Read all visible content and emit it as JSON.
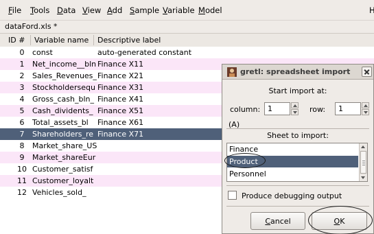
{
  "menubar": {
    "items": [
      {
        "accel": "F",
        "rest": "ile"
      },
      {
        "accel": "T",
        "rest": "ools"
      },
      {
        "accel": "D",
        "rest": "ata"
      },
      {
        "accel": "V",
        "rest": "iew"
      },
      {
        "accel": "A",
        "rest": "dd"
      },
      {
        "accel": "S",
        "rest": "ample"
      },
      {
        "accel": "V",
        "rest": "ariable"
      },
      {
        "accel": "M",
        "rest": "odel"
      }
    ],
    "partial_item": "H"
  },
  "window": {
    "filename": "dataFord.xls *"
  },
  "table": {
    "headers": {
      "id": "ID #",
      "name": "Variable name",
      "desc": "Descriptive label"
    },
    "rows": [
      {
        "id": "0",
        "name": "const",
        "desc": "auto-generated constant"
      },
      {
        "id": "1",
        "name": "Net_income__bln",
        "desc": "Finance X11"
      },
      {
        "id": "2",
        "name": "Sales_Revenues_",
        "desc": "Finance X21"
      },
      {
        "id": "3",
        "name": "Stockholdersequ",
        "desc": "Finance X31"
      },
      {
        "id": "4",
        "name": "Gross_cash_bln_",
        "desc": "Finance X41"
      },
      {
        "id": "5",
        "name": "Cash_dividents_",
        "desc": "Finance X51"
      },
      {
        "id": "6",
        "name": "Total_assets_bl",
        "desc": "Finance X61"
      },
      {
        "id": "7",
        "name": "Shareholders_re",
        "desc": "Finance X71"
      },
      {
        "id": "8",
        "name": "Market_share_US",
        "desc": ""
      },
      {
        "id": "9",
        "name": "Market_shareEur",
        "desc": ""
      },
      {
        "id": "10",
        "name": "Customer_satisf",
        "desc": ""
      },
      {
        "id": "11",
        "name": "Customer_loyalt",
        "desc": ""
      },
      {
        "id": "12",
        "name": "Vehicles_sold_",
        "desc": ""
      }
    ],
    "selected_row_id": "7"
  },
  "dialog": {
    "title": "gretl: spreadsheet import",
    "start_label": "Start import at:",
    "column_label": "column:",
    "column_value": "1",
    "row_label": "row:",
    "row_value": "1",
    "cell_ref": "(A)",
    "sheet_label": "Sheet to import:",
    "sheets": [
      "Finance",
      "Product",
      "Personnel"
    ],
    "selected_sheet": "Product",
    "debug_label": "Produce debugging output",
    "debug_checked": false,
    "cancel_accel": "C",
    "cancel_rest": "ancel",
    "ok_accel": "O",
    "ok_rest": "K"
  },
  "colors": {
    "selection": "#4f6079",
    "odd_row": "#fbe6f8",
    "window_bg": "#efebe7"
  }
}
